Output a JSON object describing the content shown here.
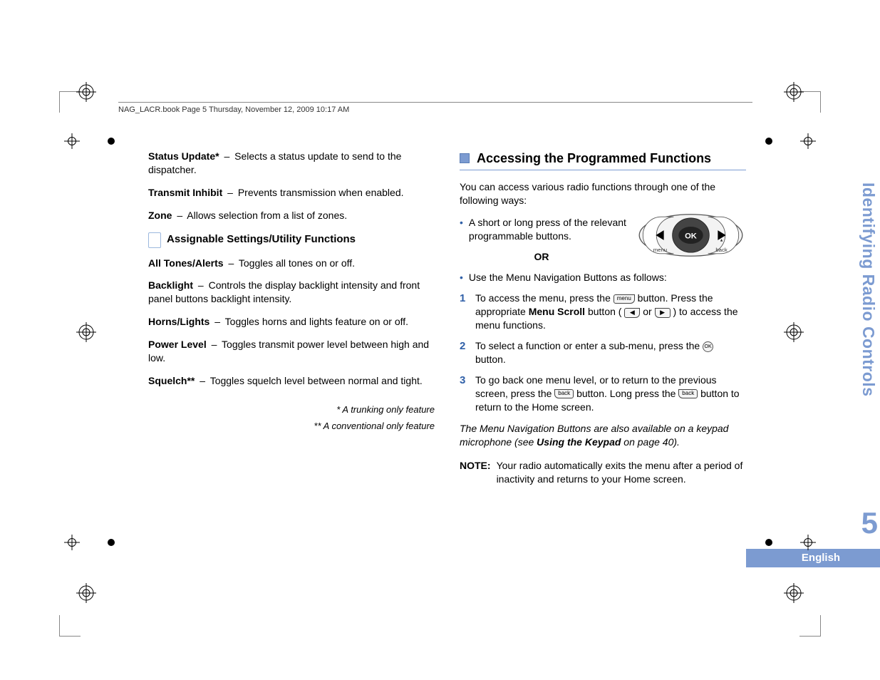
{
  "header": {
    "book_line": "NAG_LACR.book  Page 5  Thursday, November 12, 2009  10:17 AM"
  },
  "left": {
    "entries_a": [
      {
        "term": "Status Update*",
        "desc": "Selects a status update to send to the dispatcher."
      },
      {
        "term": "Transmit Inhibit",
        "desc": "Prevents transmission when enabled."
      },
      {
        "term": "Zone",
        "desc": "Allows selection from a list of zones."
      }
    ],
    "subheading": "Assignable Settings/Utility Functions",
    "entries_b": [
      {
        "term": "All Tones/Alerts",
        "desc": "Toggles all tones on or off."
      },
      {
        "term": "Backlight",
        "desc": "Controls the display backlight intensity and front panel buttons backlight intensity."
      },
      {
        "term": "Horns/Lights",
        "desc": "Toggles horns and lights feature on or off."
      },
      {
        "term": "Power Level",
        "desc": "Toggles transmit power level between high and low."
      },
      {
        "term": "Squelch**",
        "desc": "Toggles squelch level between normal and tight."
      }
    ],
    "footnotes": [
      "* A trunking only feature",
      "** A conventional only feature"
    ]
  },
  "right": {
    "heading": "Accessing the Programmed Functions",
    "intro": "You can access various radio functions through one of the following ways:",
    "bullet1": "A short or long press of the relevant programmable buttons.",
    "or_label": "OR",
    "bullet2": "Use the Menu Navigation Buttons as follows:",
    "steps": {
      "s1a": "To access the menu, press the ",
      "s1b": " button. Press the appropriate ",
      "s1_bold": "Menu Scroll",
      "s1c": " button (",
      "s1d": " or ",
      "s1e": ") to access the menu functions.",
      "s2a": "To select a function or enter a sub-menu, press the ",
      "s2b": " button.",
      "s3a": "To go back one menu level, or to return to the previous screen, press the ",
      "s3b": " button. Long press the ",
      "s3c": " button to return to the Home screen."
    },
    "italic_a": "The Menu Navigation Buttons are also available on a keypad microphone (see ",
    "italic_bold": "Using the Keypad",
    "italic_b": " on page 40).",
    "note_label": "NOTE:",
    "note_text": "Your radio automatically exits the menu after a period of inactivity and returns to your Home screen."
  },
  "side": {
    "title": "Identifying Radio Controls",
    "page_number": "5",
    "language": "English"
  },
  "icons": {
    "menu": "menu",
    "ok": "OK",
    "back": "back",
    "home_back": "back"
  }
}
